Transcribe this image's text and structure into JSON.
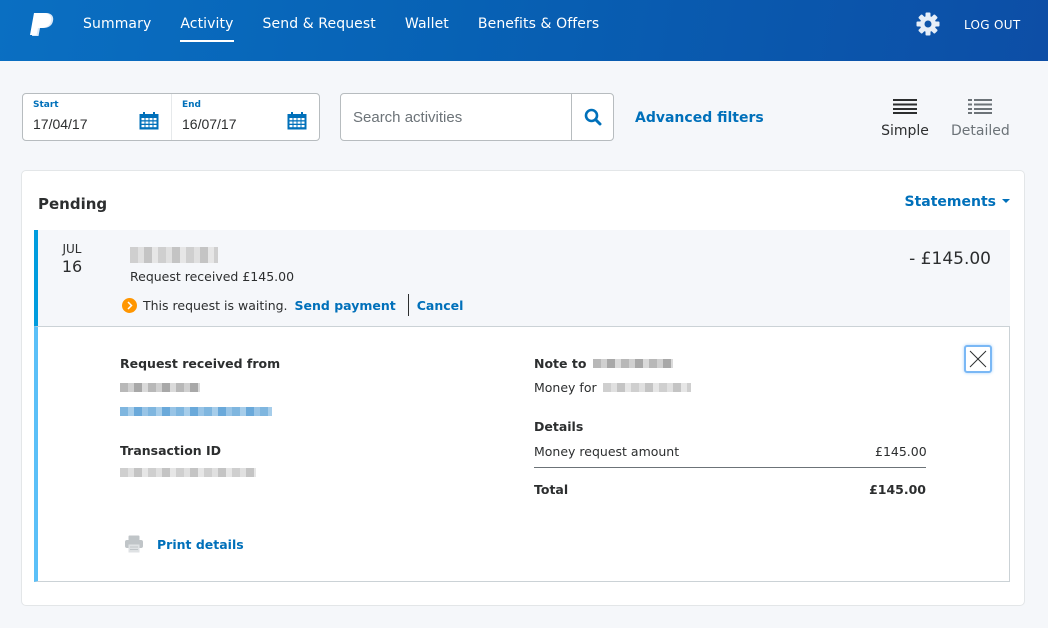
{
  "header": {
    "logo": "paypal-logo",
    "nav": [
      {
        "label": "Summary",
        "active": false
      },
      {
        "label": "Activity",
        "active": true
      },
      {
        "label": "Send & Request",
        "active": false
      },
      {
        "label": "Wallet",
        "active": false
      },
      {
        "label": "Benefits & Offers",
        "active": false
      }
    ],
    "settings_icon": "gear-icon",
    "logout_label": "LOG OUT"
  },
  "filters": {
    "start_label": "Start",
    "start_value": "17/04/17",
    "end_label": "End",
    "end_value": "16/07/17",
    "search_placeholder": "Search activities",
    "search_value": "",
    "advanced_filters_label": "Advanced filters",
    "views": [
      {
        "label": "Simple",
        "selected": true,
        "icon": "list-simple-icon"
      },
      {
        "label": "Detailed",
        "selected": false,
        "icon": "list-detailed-icon"
      }
    ]
  },
  "pending": {
    "title": "Pending",
    "statements_label": "Statements",
    "transaction": {
      "month": "JUL",
      "day": "16",
      "name": "[redacted]",
      "subtitle": "Request received £145.00",
      "status_text": "This request is waiting.",
      "send_payment_label": "Send payment",
      "cancel_label": "Cancel",
      "amount": "- £145.00"
    },
    "details": {
      "from_heading": "Request received from",
      "from_name": "[redacted]",
      "from_email": "[redacted]",
      "txn_heading": "Transaction ID",
      "txn_id": "[redacted]",
      "note_heading": "Note to",
      "note_recipient": "[redacted]",
      "note_text": "Money for",
      "note_subject": "[redacted]",
      "details_heading": "Details",
      "line_items": [
        {
          "label": "Money request amount",
          "value": "£145.00"
        }
      ],
      "total_label": "Total",
      "total_value": "£145.00",
      "print_label": "Print details"
    }
  },
  "colors": {
    "brand_blue": "#0070ba",
    "header_gradient": [
      "#0a6fc2",
      "#0d4ea6"
    ],
    "pending_accent": "#009cde",
    "detail_accent": "#5bc0f8",
    "warning": "#ff9600"
  }
}
